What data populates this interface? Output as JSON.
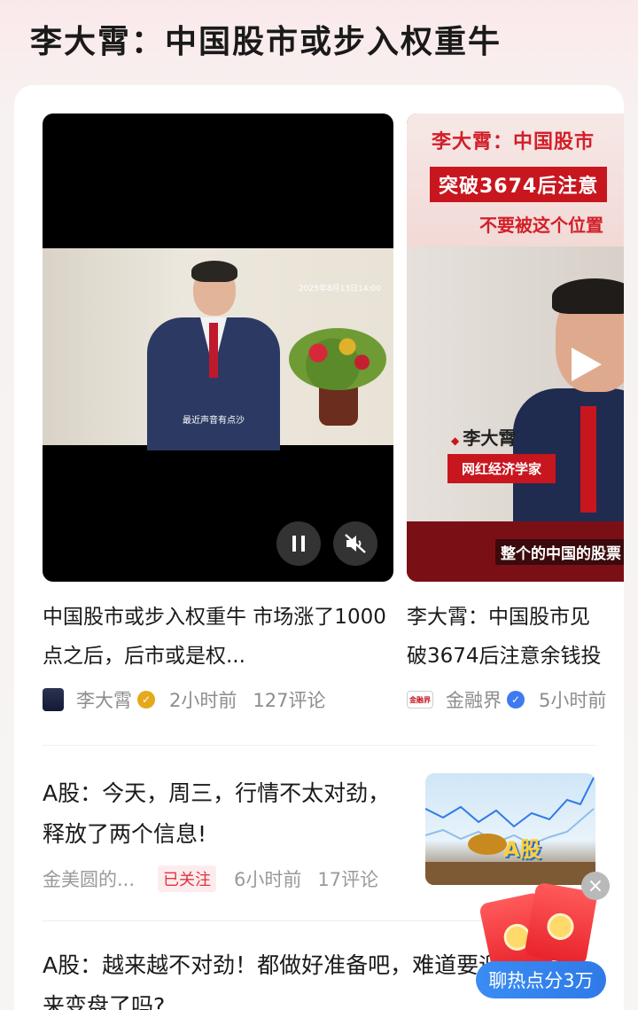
{
  "page": {
    "title": "李大霄：中国股市或步入权重牛"
  },
  "videos": [
    {
      "timestamp": "2025年8月13日14:00",
      "caption": "最近声音有点沙",
      "title": "中国股市或步入权重牛 市场涨了1000点之后，后市或是权...",
      "author": "李大霄",
      "verified_color": "#e5a91c",
      "time": "2小时前",
      "comments": "127评论",
      "controls": [
        "pause-icon",
        "muted-icon"
      ]
    },
    {
      "overlay_line1": "李大霄：中国股市",
      "overlay_line2": "突破3674后注意",
      "overlay_line3": "不要被这个位置",
      "name_tag": "李大霄",
      "role_tag": "网红经济学家",
      "bottom_caption": "整个的中国的股票",
      "title_line1": "李大霄：中国股市见",
      "title_line2": "破3674后注意余钱投",
      "author": "金融界",
      "author_logo": "金融界",
      "verified_color": "#3f7af0",
      "time": "5小时前"
    }
  ],
  "articles": [
    {
      "title": "A股：今天，周三，行情不太对劲，释放了两个信息!",
      "author": "金美圆的...",
      "follow_label": "已关注",
      "time": "6小时前",
      "comments": "17评论",
      "thumb_text": "A股"
    },
    {
      "title": "A股：越来越不对劲！都做好准备吧，难道要迎来变盘了吗?"
    }
  ],
  "widget": {
    "close_icon": "×",
    "label": "聊热点分3万"
  }
}
